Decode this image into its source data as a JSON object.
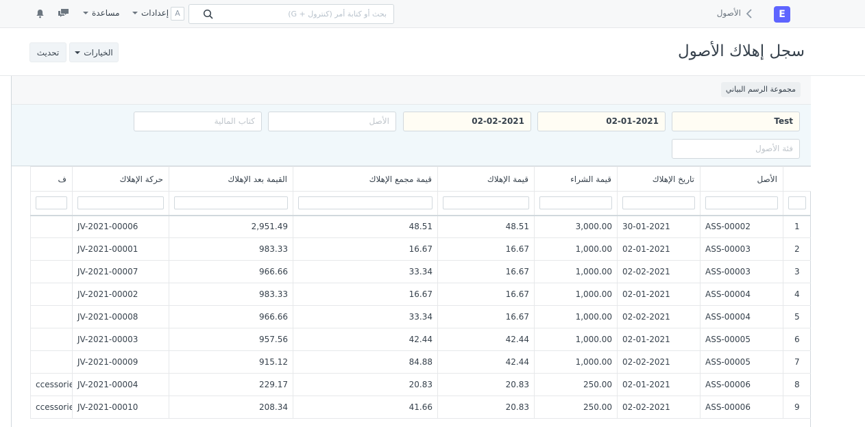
{
  "navbar": {
    "logo_letter": "E",
    "breadcrumb": "الأصول",
    "search_placeholder": "بحث أو كتابة أمر (كنترول + G)",
    "avatar_letter": "A",
    "settings_label": "إعدادات",
    "help_label": "مساعدة",
    "icons": [
      "chevron-left-icon",
      "search-icon",
      "chat-icon",
      "bell-icon"
    ]
  },
  "page": {
    "title": "سجل إهلاك الأصول",
    "options_label": "الخيارات",
    "refresh_label": "تحديث"
  },
  "chart_group_label": "مجموعة الرسم البياني",
  "filters": {
    "company": {
      "value": "Test"
    },
    "from_date": {
      "value": "02-01-2021"
    },
    "to_date": {
      "value": "02-02-2021"
    },
    "asset": {
      "placeholder": "الأصل"
    },
    "finance_book": {
      "placeholder": "كتاب المالية"
    },
    "asset_category": {
      "placeholder": "فئة الأصول"
    }
  },
  "table": {
    "columns": [
      "الأصل",
      "تاريخ الإهلاك",
      "قيمة الشراء",
      "قيمة الإهلاك",
      "قيمة مجمع الإهلاك",
      "القيمة بعد الإهلاك",
      "حركة الإهلاك",
      "ف"
    ],
    "rows": [
      {
        "idx": "1",
        "asset": "ASS-00002",
        "date": "30-01-2021",
        "purchase": "3,000.00",
        "dep": "48.51",
        "accum": "48.51",
        "after": "2,951.49",
        "je": "JV-2021-00006",
        "category": ""
      },
      {
        "idx": "2",
        "asset": "ASS-00003",
        "date": "02-01-2021",
        "purchase": "1,000.00",
        "dep": "16.67",
        "accum": "16.67",
        "after": "983.33",
        "je": "JV-2021-00001",
        "category": ""
      },
      {
        "idx": "3",
        "asset": "ASS-00003",
        "date": "02-02-2021",
        "purchase": "1,000.00",
        "dep": "16.67",
        "accum": "33.34",
        "after": "966.66",
        "je": "JV-2021-00007",
        "category": ""
      },
      {
        "idx": "4",
        "asset": "ASS-00004",
        "date": "02-01-2021",
        "purchase": "1,000.00",
        "dep": "16.67",
        "accum": "16.67",
        "after": "983.33",
        "je": "JV-2021-00002",
        "category": ""
      },
      {
        "idx": "5",
        "asset": "ASS-00004",
        "date": "02-02-2021",
        "purchase": "1,000.00",
        "dep": "16.67",
        "accum": "33.34",
        "after": "966.66",
        "je": "JV-2021-00008",
        "category": ""
      },
      {
        "idx": "6",
        "asset": "ASS-00005",
        "date": "02-01-2021",
        "purchase": "1,000.00",
        "dep": "42.44",
        "accum": "42.44",
        "after": "957.56",
        "je": "JV-2021-00003",
        "category": ""
      },
      {
        "idx": "7",
        "asset": "ASS-00005",
        "date": "02-02-2021",
        "purchase": "1,000.00",
        "dep": "42.44",
        "accum": "84.88",
        "after": "915.12",
        "je": "JV-2021-00009",
        "category": ""
      },
      {
        "idx": "8",
        "asset": "ASS-00006",
        "date": "02-01-2021",
        "purchase": "250.00",
        "dep": "20.83",
        "accum": "20.83",
        "after": "229.17",
        "je": "JV-2021-00004",
        "category": "ccessories"
      },
      {
        "idx": "9",
        "asset": "ASS-00006",
        "date": "02-02-2021",
        "purchase": "250.00",
        "dep": "20.83",
        "accum": "41.66",
        "after": "208.34",
        "je": "JV-2021-00010",
        "category": "ccessories"
      }
    ]
  },
  "colors": {
    "brand": "#5e64ff",
    "filter_bg": "#f1f8fb",
    "required_bg": "#fffdf4"
  }
}
